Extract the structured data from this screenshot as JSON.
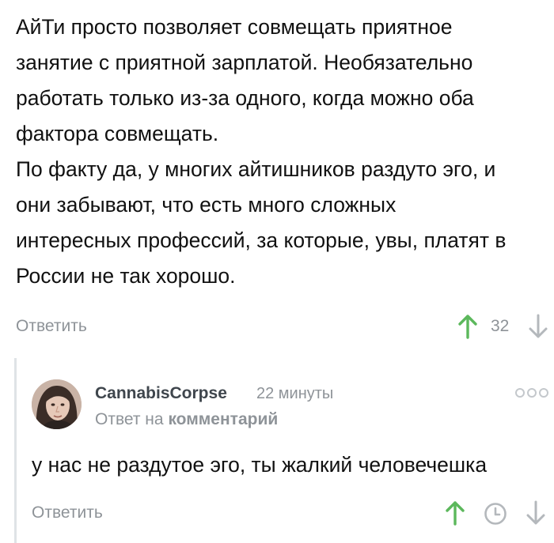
{
  "parent_comment": {
    "lines": [
      "АйТи просто позволяет совмещать приятное",
      "занятие с приятной зарплатой. Необязательно",
      "работать только из-за одного, когда можно оба",
      "фактора совмещать.",
      "По факту да, у многих айтишников раздуто эго, и",
      "они забывают, что есть много сложных",
      "интересных профессий, за которые, увы, платят в",
      "России не так хорошо."
    ],
    "reply_label": "Ответить",
    "rating": "32"
  },
  "reply_comment": {
    "author": "CannabisCorpse",
    "time": "22 минуты",
    "reply_to_prefix": "Ответ на",
    "reply_to_target": "комментарий",
    "text": "у нас не раздутое эго, ты жалкий человечешка",
    "reply_label": "Ответить"
  },
  "colors": {
    "upvote": "#5cb85c",
    "muted": "#8e9398",
    "thread_line": "#dfe3e6"
  },
  "icons": [
    "upvote-arrow-icon",
    "downvote-arrow-icon",
    "clock-icon",
    "more-dots-icon"
  ]
}
